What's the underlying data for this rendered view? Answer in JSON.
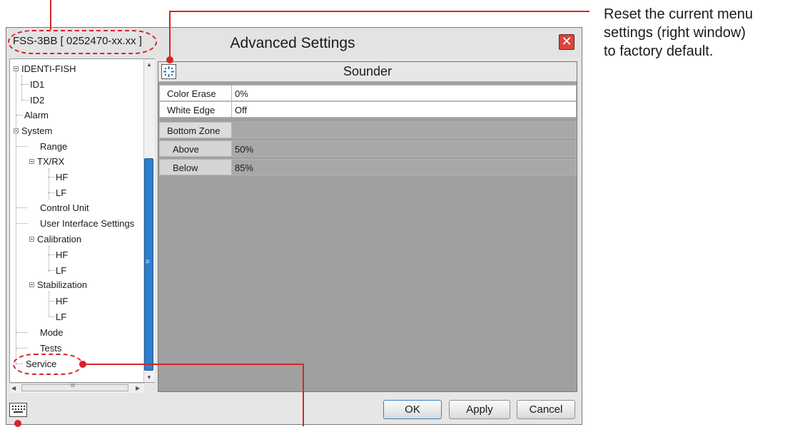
{
  "window": {
    "model_label": "FSS-3BB [ 0252470-xx.xx ]",
    "title": "Advanced Settings",
    "close_glyph": "✕"
  },
  "tree": {
    "items": [
      {
        "label": "IDENTI-FISH"
      },
      {
        "label": "ID1"
      },
      {
        "label": "ID2"
      },
      {
        "label": "Alarm"
      },
      {
        "label": "System"
      },
      {
        "label": "Range"
      },
      {
        "label": "TX/RX"
      },
      {
        "label": "HF"
      },
      {
        "label": "LF"
      },
      {
        "label": "Control Unit"
      },
      {
        "label": "User Interface Settings"
      },
      {
        "label": "Calibration"
      },
      {
        "label": "HF"
      },
      {
        "label": "LF"
      },
      {
        "label": "Stabilization"
      },
      {
        "label": "HF"
      },
      {
        "label": "LF"
      },
      {
        "label": "Mode"
      },
      {
        "label": "Tests"
      },
      {
        "label": "Service"
      }
    ]
  },
  "panel": {
    "title": "Sounder",
    "reset_icon": "reset-icon",
    "rows": [
      {
        "label": "Color Erase",
        "value": "0%"
      },
      {
        "label": "White Edge",
        "value": "Off"
      },
      {
        "label": "Bottom Zone",
        "value": ""
      },
      {
        "label": "Above",
        "value": "50%"
      },
      {
        "label": "Below",
        "value": "85%"
      }
    ]
  },
  "buttons": {
    "ok": "OK",
    "apply": "Apply",
    "cancel": "Cancel"
  },
  "scrollbar_glyph": "≡",
  "hscroll_glyph": "III",
  "annotation": {
    "note_line1": "Reset the current menu",
    "note_line2": "settings (right window)",
    "note_line3": "to factory default."
  },
  "colors": {
    "annotation_red": "#d6252a",
    "scroll_thumb": "#2f7fcb",
    "close_red": "#d9453b"
  }
}
